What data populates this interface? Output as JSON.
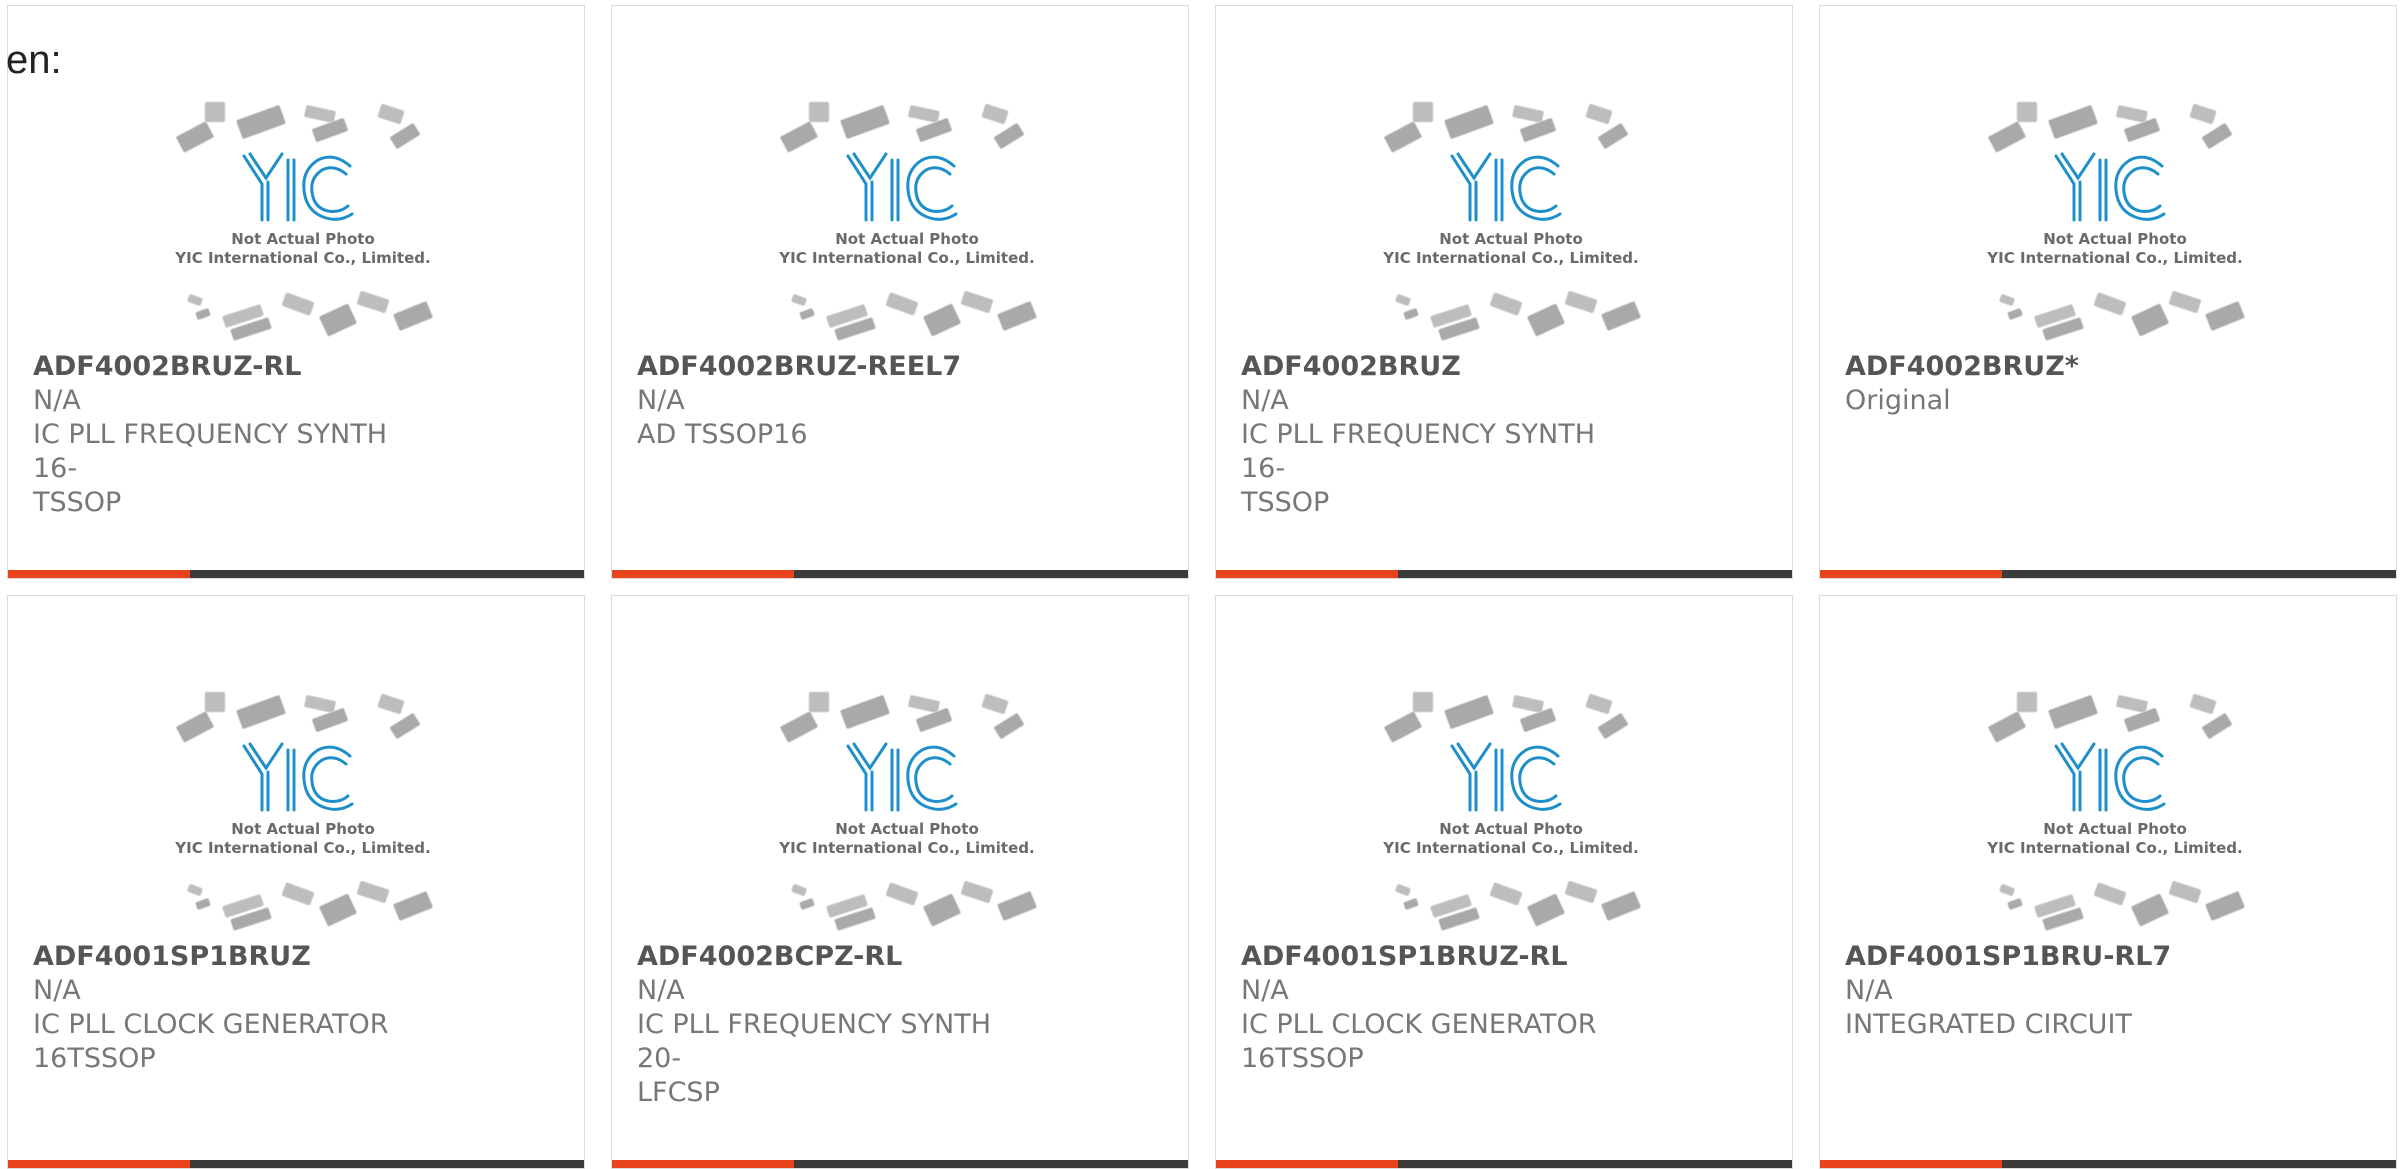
{
  "page": {
    "lang_label": "en:",
    "placeholder_line1": "Not Actual Photo",
    "placeholder_line2": "YIC International Co., Limited.",
    "placeholder_logo": "YIC"
  },
  "colors": {
    "accent": "#e8431b",
    "bar": "#3b3b3b",
    "logo": "#1f8fc9"
  },
  "products": [
    {
      "part": "ADF4002BRUZ-RL",
      "line1": "N/A",
      "line2": "IC PLL FREQUENCY SYNTH 16-",
      "line3": "TSSOP"
    },
    {
      "part": "ADF4002BRUZ-REEL7",
      "line1": "N/A",
      "line2": "AD TSSOP16",
      "line3": ""
    },
    {
      "part": "ADF4002BRUZ",
      "line1": "N/A",
      "line2": "IC PLL FREQUENCY SYNTH 16-",
      "line3": "TSSOP"
    },
    {
      "part": "ADF4002BRUZ*",
      "line1": "Original",
      "line2": "",
      "line3": ""
    },
    {
      "part": "ADF4001SP1BRUZ",
      "line1": "N/A",
      "line2": "IC PLL CLOCK GENERATOR",
      "line3": "16TSSOP"
    },
    {
      "part": "ADF4002BCPZ-RL",
      "line1": "N/A",
      "line2": "IC PLL FREQUENCY SYNTH 20-",
      "line3": "LFCSP"
    },
    {
      "part": "ADF4001SP1BRUZ-RL",
      "line1": "N/A",
      "line2": "IC PLL CLOCK GENERATOR",
      "line3": "16TSSOP"
    },
    {
      "part": "ADF4001SP1BRU-RL7",
      "line1": "N/A",
      "line2": "INTEGRATED CIRCUIT",
      "line3": ""
    }
  ]
}
